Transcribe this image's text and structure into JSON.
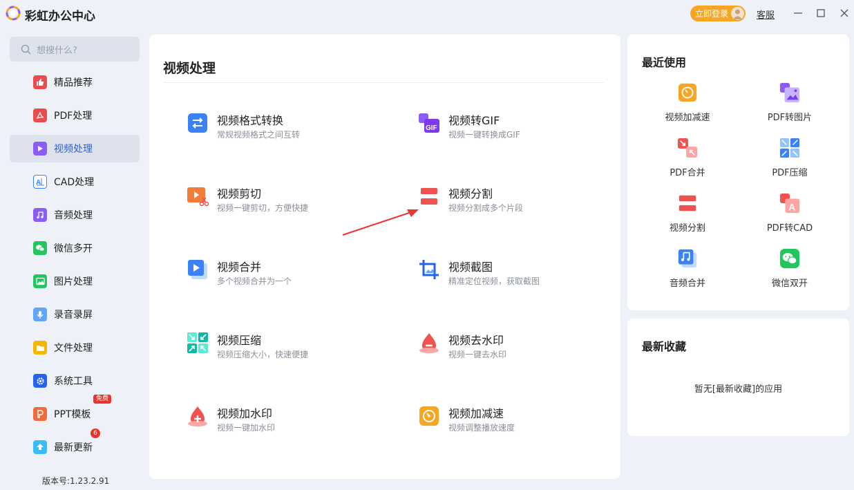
{
  "app": {
    "title": "彩虹办公中心",
    "login_label": "立即登录",
    "support_label": "客服",
    "version": "版本号:1.23.2.91"
  },
  "search": {
    "placeholder": "想搜什么?"
  },
  "sidebar": {
    "items": [
      {
        "label": "精品推荐",
        "icon": "thumbs-up-icon",
        "color": "#e84c4c"
      },
      {
        "label": "PDF处理",
        "icon": "pdf-icon",
        "color": "#e84c4c"
      },
      {
        "label": "视频处理",
        "icon": "video-play-icon",
        "color": "#8b5cf6",
        "active": true
      },
      {
        "label": "CAD处理",
        "icon": "cad-icon",
        "color": "#3b82f6"
      },
      {
        "label": "音频处理",
        "icon": "music-note-icon",
        "color": "#8b5cf6"
      },
      {
        "label": "微信多开",
        "icon": "wechat-icon",
        "color": "#22c55e"
      },
      {
        "label": "图片处理",
        "icon": "image-icon",
        "color": "#22c55e"
      },
      {
        "label": "录音录屏",
        "icon": "microphone-icon",
        "color": "#60a5fa"
      },
      {
        "label": "文件处理",
        "icon": "folder-icon",
        "color": "#f5b400"
      },
      {
        "label": "系统工具",
        "icon": "gear-icon",
        "color": "#2563eb"
      },
      {
        "label": "PPT模板",
        "icon": "ppt-icon",
        "color": "#f06a3a",
        "badge": "免费"
      },
      {
        "label": "最新更新",
        "icon": "upload-arrow-icon",
        "color": "#38bdf8",
        "badge": "6"
      }
    ]
  },
  "main": {
    "title": "视频处理",
    "tools": [
      {
        "name": "视频格式转换",
        "desc": "常规视频格式之间互转",
        "icon": "convert-arrows-icon"
      },
      {
        "name": "视频转GIF",
        "desc": "视频一键转换成GIF",
        "icon": "gif-icon"
      },
      {
        "name": "视频剪切",
        "desc": "视频一键剪切，方便快捷",
        "icon": "video-cut-icon"
      },
      {
        "name": "视频分割",
        "desc": "视频分割成多个片段",
        "icon": "split-icon"
      },
      {
        "name": "视频合并",
        "desc": "多个视频合并为一个",
        "icon": "video-merge-icon"
      },
      {
        "name": "视频截图",
        "desc": "精准定位视频，获取截图",
        "icon": "crop-screenshot-icon"
      },
      {
        "name": "视频压缩",
        "desc": "视频压缩大小，快速便捷",
        "icon": "compress-icon"
      },
      {
        "name": "视频去水印",
        "desc": "视频一键去水印",
        "icon": "remove-watermark-icon"
      },
      {
        "name": "视频加水印",
        "desc": "视频一键加水印",
        "icon": "add-watermark-icon"
      },
      {
        "name": "视频加减速",
        "desc": "视频调整播放速度",
        "icon": "speed-icon"
      }
    ]
  },
  "recent": {
    "title": "最近使用",
    "items": [
      {
        "label": "视频加减速",
        "icon": "speed-icon"
      },
      {
        "label": "PDF转图片",
        "icon": "pdf-to-image-icon"
      },
      {
        "label": "PDF合并",
        "icon": "pdf-merge-icon"
      },
      {
        "label": "PDF压缩",
        "icon": "pdf-compress-icon"
      },
      {
        "label": "视频分割",
        "icon": "split-icon"
      },
      {
        "label": "PDF转CAD",
        "icon": "pdf-to-cad-icon"
      },
      {
        "label": "音频合并",
        "icon": "audio-merge-icon"
      },
      {
        "label": "微信双开",
        "icon": "wechat-icon"
      }
    ]
  },
  "favorites": {
    "title": "最新收藏",
    "empty_text": "暂无[最新收藏]的应用"
  }
}
